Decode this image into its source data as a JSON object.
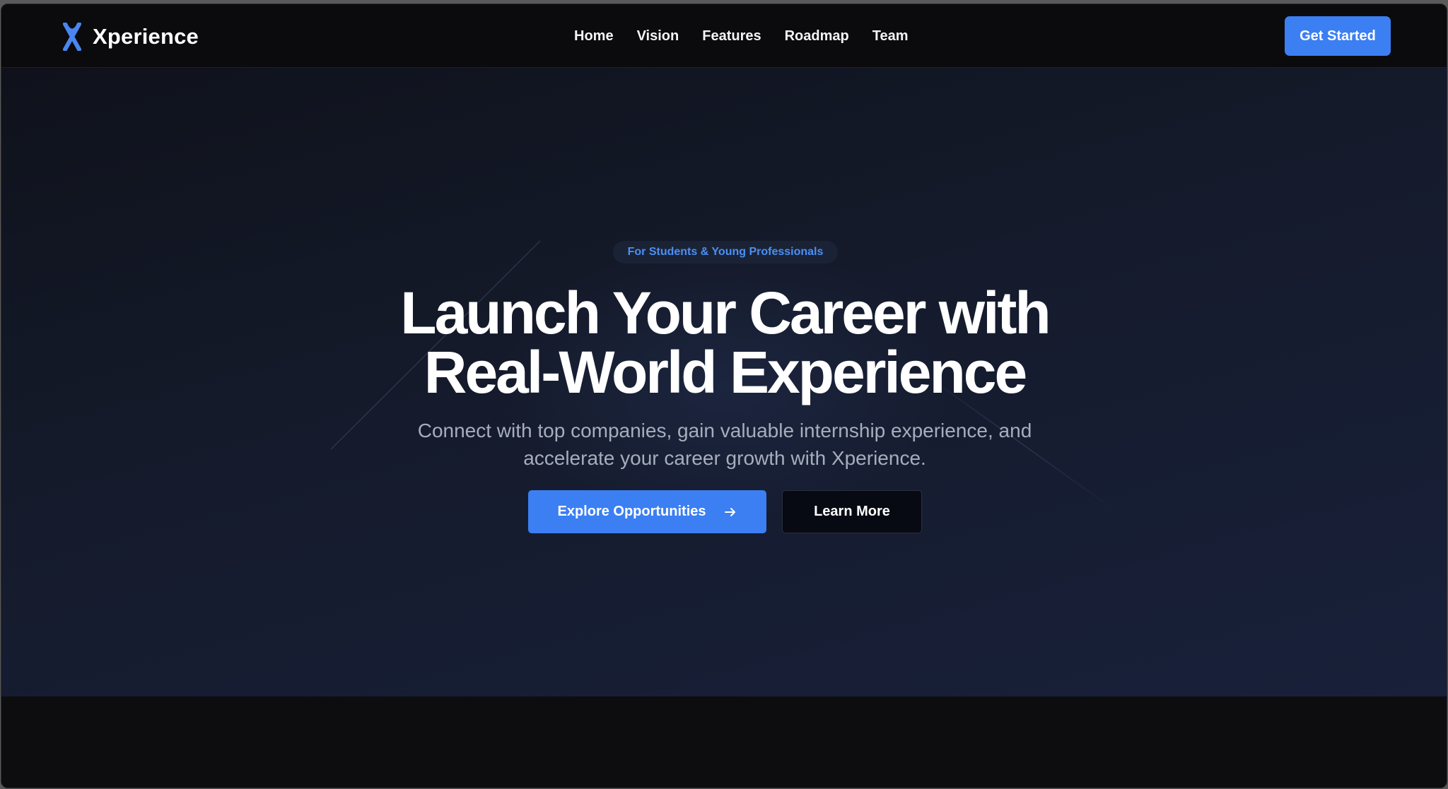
{
  "brand": {
    "name": "Xperience",
    "accent_color": "#3b7ff2",
    "logo_icon": "x-logo-icon"
  },
  "nav": {
    "links": [
      {
        "label": "Home"
      },
      {
        "label": "Vision"
      },
      {
        "label": "Features"
      },
      {
        "label": "Roadmap"
      },
      {
        "label": "Team"
      }
    ],
    "cta_label": "Get Started"
  },
  "hero": {
    "badge": "For Students & Young Professionals",
    "title_line1": "Launch Your Career with",
    "title_line2": "Real-World Experience",
    "subtitle_line1": "Connect with top companies, gain valuable internship experience, and",
    "subtitle_line2": "accelerate your career growth with Xperience.",
    "primary_button": "Explore Opportunities",
    "primary_button_icon": "arrow-right-icon",
    "secondary_button": "Learn More"
  }
}
